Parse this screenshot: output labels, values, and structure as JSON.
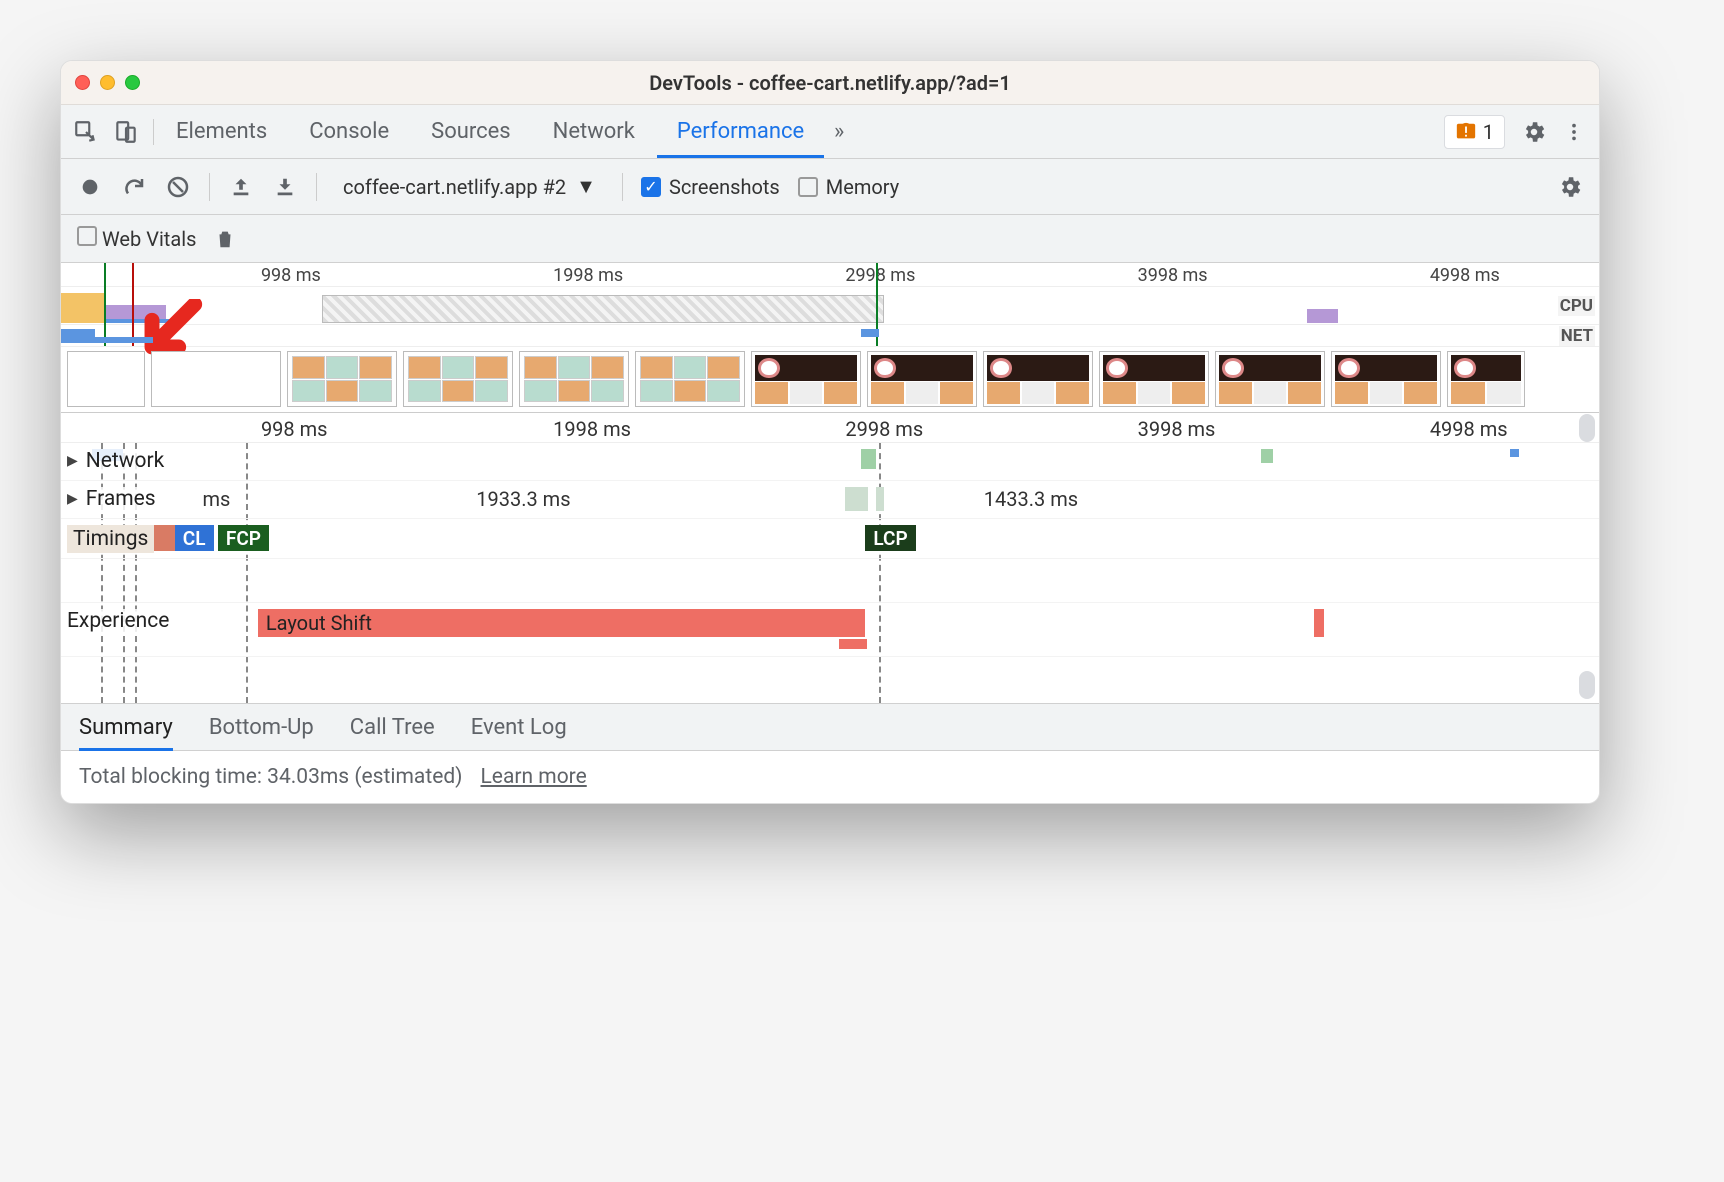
{
  "window": {
    "title": "DevTools - coffee-cart.netlify.app/?ad=1"
  },
  "tabs": {
    "items": [
      "Elements",
      "Console",
      "Sources",
      "Network",
      "Performance"
    ],
    "active": "Performance",
    "issues_count": "1"
  },
  "toolbar": {
    "profile_label": "coffee-cart.netlify.app #2",
    "screenshots_label": "Screenshots",
    "screenshots_checked": true,
    "memory_label": "Memory",
    "memory_checked": false
  },
  "toolbar2": {
    "web_vitals_label": "Web Vitals",
    "web_vitals_checked": false
  },
  "overview": {
    "ticks": [
      "998 ms",
      "1998 ms",
      "2998 ms",
      "3998 ms",
      "4998 ms"
    ],
    "labels": {
      "cpu": "CPU",
      "net": "NET"
    }
  },
  "flame_ruler": {
    "ticks": [
      "998 ms",
      "1998 ms",
      "2998 ms",
      "3998 ms",
      "4998 ms"
    ]
  },
  "tracks": {
    "network": "Network",
    "frames": "Frames",
    "frame_segments": [
      {
        "label": "ms",
        "center_pct": 7
      },
      {
        "label": "1933.3 ms",
        "center_pct": 28
      },
      {
        "label": "1433.3 ms",
        "center_pct": 60
      }
    ],
    "timings": {
      "label": "Timings",
      "cl": "CL",
      "fcp": "FCP",
      "lcp": "LCP"
    },
    "experience": {
      "label": "Experience",
      "layout_shift": "Layout Shift"
    }
  },
  "bottom_tabs": {
    "items": [
      "Summary",
      "Bottom-Up",
      "Call Tree",
      "Event Log"
    ],
    "active": "Summary"
  },
  "status": {
    "text": "Total blocking time: 34.03ms (estimated)",
    "link": "Learn more"
  }
}
